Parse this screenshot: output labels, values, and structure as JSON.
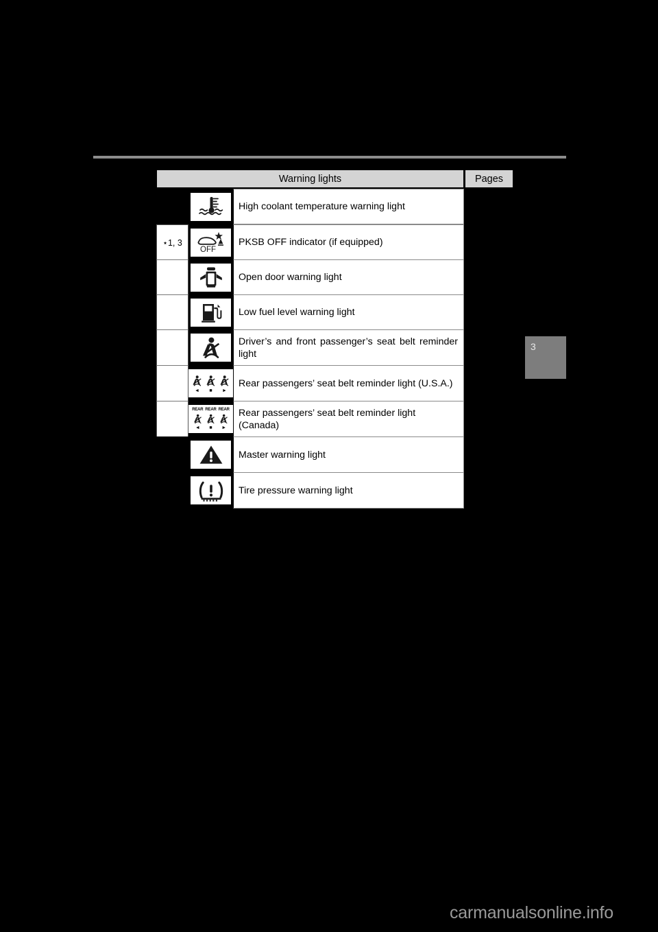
{
  "page": {
    "side_tab_number": "3",
    "watermark": "carmanualsonline.info"
  },
  "table": {
    "header": {
      "warning_lights": "Warning lights",
      "pages": "Pages"
    },
    "rows": [
      {
        "footnote": "",
        "footnote_cell_white": false,
        "icon": "high-coolant-temperature-icon",
        "label": "High coolant temperature warning light",
        "pages": ""
      },
      {
        "footnote": "⋆1, 3",
        "footnote_cell_white": true,
        "icon": "pksb-off-icon",
        "label": "PKSB OFF indicator (if equipped)",
        "pages": ""
      },
      {
        "footnote": "",
        "footnote_cell_white": true,
        "icon": "open-door-icon",
        "label": "Open door warning light",
        "pages": ""
      },
      {
        "footnote": "",
        "footnote_cell_white": true,
        "icon": "low-fuel-level-icon",
        "label": "Low fuel level warning light",
        "pages": ""
      },
      {
        "footnote": "",
        "footnote_cell_white": true,
        "icon": "front-seat-belt-reminder-icon",
        "label": "Driver’s and front passenger’s seat belt reminder light",
        "pages": ""
      },
      {
        "footnote": "",
        "footnote_cell_white": true,
        "icon": "rear-seat-belt-reminder-usa-icon",
        "label": "Rear passengers’ seat belt reminder light (U.S.A.)",
        "pages": ""
      },
      {
        "footnote": "",
        "footnote_cell_white": true,
        "icon": "rear-seat-belt-reminder-canada-icon",
        "label": "Rear passengers’ seat belt reminder light (Canada)",
        "pages": ""
      },
      {
        "footnote": "",
        "footnote_cell_white": false,
        "icon": "master-warning-icon",
        "label": "Master warning light",
        "pages": ""
      },
      {
        "footnote": "",
        "footnote_cell_white": false,
        "icon": "tire-pressure-warning-icon",
        "label": "Tire pressure warning light",
        "pages": ""
      }
    ]
  },
  "icons": {
    "rear_label": "REAR",
    "off_label": "OFF"
  },
  "colors": {
    "page_background": "#000000",
    "header_fill": "#d4d4d4",
    "cell_fill": "#ffffff",
    "rule": "#8c8c8c",
    "side_tab": "#7d7d7d",
    "watermark": "#9a9a9a"
  }
}
